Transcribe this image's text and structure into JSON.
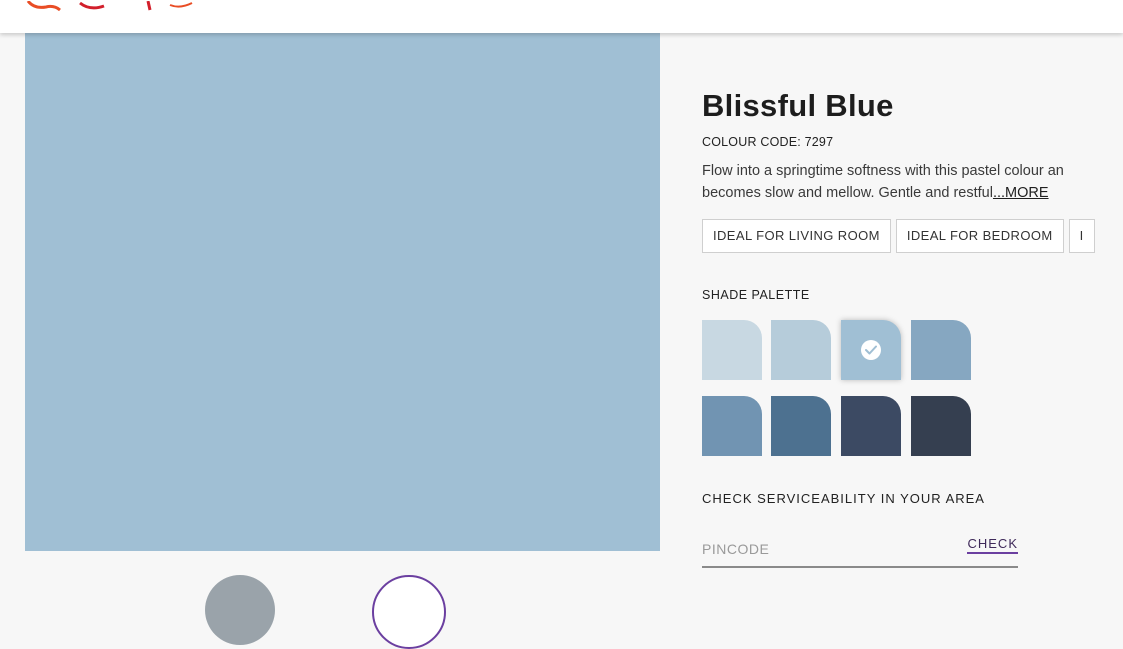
{
  "header": {
    "logo_icon": "brand-logo-icon",
    "logo_colors": [
      "#e94d25",
      "#d21f2b"
    ]
  },
  "preview": {
    "main_color": "#a0bfd4",
    "thumbnails": [
      {
        "icon": "room-view-thumbnail",
        "color": "#9aa3aa"
      },
      {
        "icon": "colour-view-thumbnail",
        "color": "#6b3fa0"
      }
    ]
  },
  "product": {
    "name": "Blissful Blue",
    "colour_code": "COLOUR CODE: 7297",
    "description_line1": "Flow into a springtime softness with this pastel colour an",
    "description_line2": "becomes slow and mellow. Gentle and restful",
    "more_label": "...MORE",
    "tags": [
      "IDEAL FOR LIVING ROOM",
      "IDEAL FOR BEDROOM",
      "I"
    ]
  },
  "shade_palette": {
    "label": "SHADE PALETTE",
    "selected_index": 2,
    "shades": [
      {
        "color": "#c8d8e2"
      },
      {
        "color": "#b6ccda"
      },
      {
        "color": "#a0bfd4"
      },
      {
        "color": "#86a7c1"
      },
      {
        "color": "#7194b2"
      },
      {
        "color": "#4d7190"
      },
      {
        "color": "#3c4a63"
      },
      {
        "color": "#353f50"
      }
    ]
  },
  "serviceability": {
    "label": "CHECK SERVICEABILITY IN YOUR AREA",
    "pincode_placeholder": "PINCODE",
    "pincode_value": "",
    "check_label": "CHECK"
  }
}
